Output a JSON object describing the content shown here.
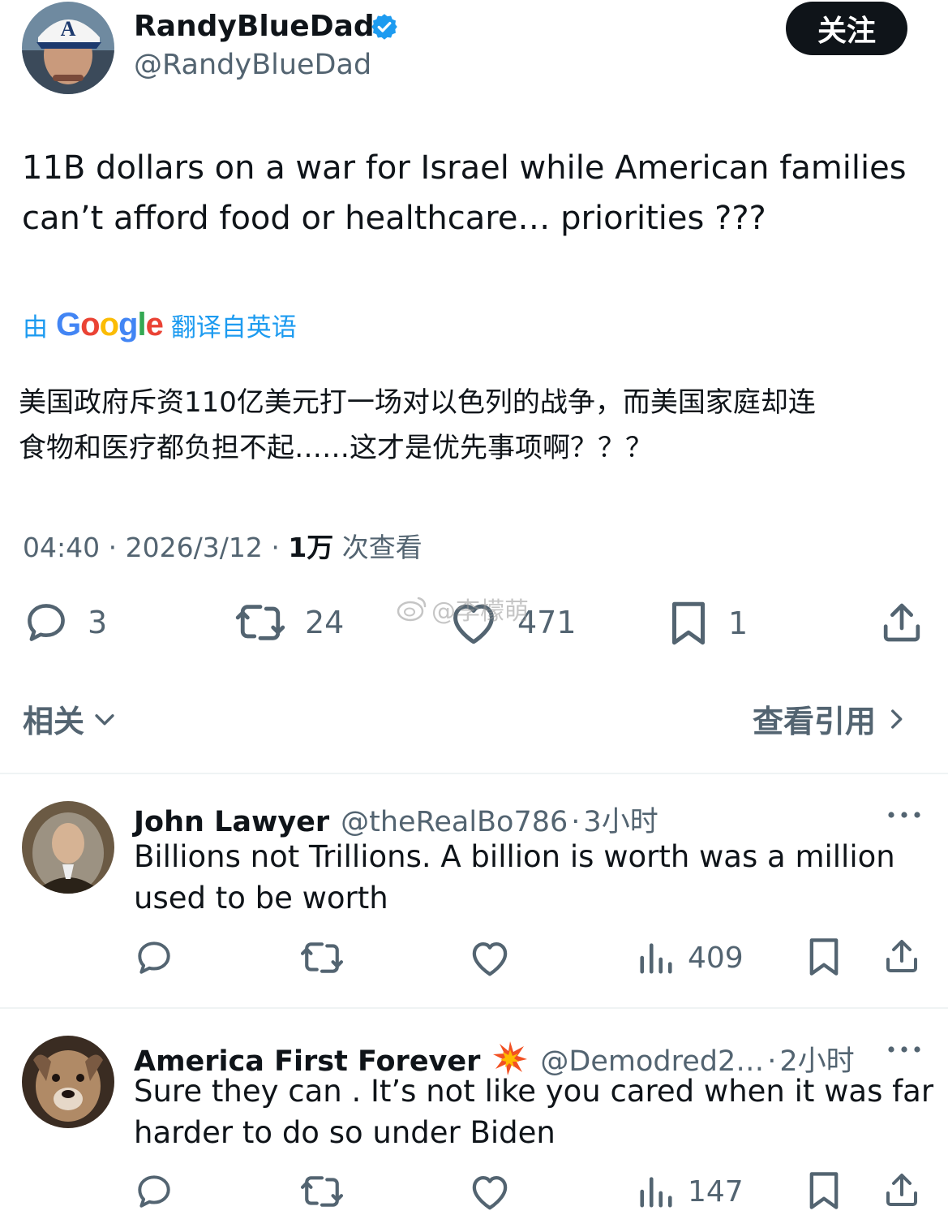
{
  "colors": {
    "text": "#0f1419",
    "secondary": "#536471",
    "link": "#1d9bf0",
    "divider": "#eff3f4"
  },
  "author": {
    "display_name": "RandyBlueDad",
    "handle": "@RandyBlueDad",
    "verified_icon": "verified-badge-icon",
    "follow_label": "关注"
  },
  "tweet": {
    "text_line1": "11B dollars on a war for Israel while American families",
    "text_line2": "can’t afford food or healthcare… priorities ???",
    "translate_prefix": "由",
    "translate_brand": "Google",
    "translate_suffix": "翻译自英语",
    "translated_line1": "美国政府斥资110亿美元打一场对以色列的战争，而美国家庭却连",
    "translated_line2": "食物和医疗都负担不起……这才是优先事项啊？？？",
    "time": "04:40",
    "date": "2026/3/12",
    "views_count": "1万",
    "views_label": "次查看",
    "separator": "·"
  },
  "actions": {
    "replies": "3",
    "retweets": "24",
    "likes": "471",
    "bookmarks": "1"
  },
  "watermark": "@李檬萌",
  "related": {
    "left_label": "相关",
    "right_label": "查看引用"
  },
  "replies": [
    {
      "name": "John Lawyer",
      "handle": "@theRealBo786",
      "time": "3小时",
      "text_line1": "Billions not Trillions. A billion is worth was a million",
      "text_line2": "used to be worth",
      "views": "409"
    },
    {
      "name": "America First Forever",
      "badge_icon": "collision-emoji-icon",
      "handle": "@Demodred2…",
      "time": "2小时",
      "text_line1": "Sure they can . It’s not like you cared when it was far",
      "text_line2": "harder to do so under Biden",
      "views": "147"
    }
  ]
}
